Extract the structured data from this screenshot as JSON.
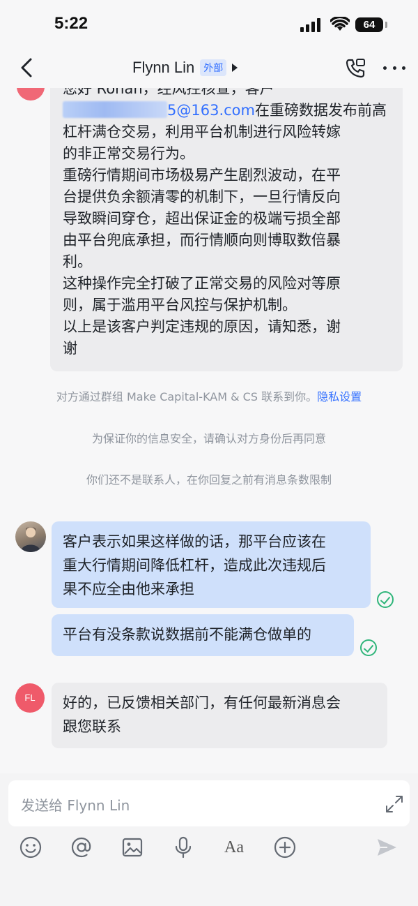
{
  "status_bar": {
    "time": "5:22",
    "battery": "64"
  },
  "nav": {
    "title": "Flynn Lin",
    "badge": "外部"
  },
  "messages": {
    "incoming_1": {
      "line1": "您好 Ronan，经风控核查，客户",
      "email_suffix": "5@163.com",
      "after_email": "在重磅数据发布前高\n杠杆满仓交易，利用平台机制进行风险转嫁\n的非正常交易行为。\n重磅行情期间市场极易产生剧烈波动，在平\n台提供负余额清零的机制下，一旦行情反向\n导致瞬间穿仓，超出保证金的极端亏损全部\n由平台兜底承担，而行情顺向则博取数倍暴\n利。\n这种操作完全打破了正常交易的风险对等原\n则，属于滥用平台风控与保护机制。\n以上是该客户判定违规的原因，请知悉，谢\n谢"
    },
    "outgoing_1": "客户表示如果这样做的话，那平台应该在\n重大行情期间降低杠杆，造成此次违规后\n果不应全由他来承担",
    "outgoing_2": "平台有没条款说数据前不能满仓做单的",
    "incoming_2": "好的，已反馈相关部门，有任何最新消息会\n跟您联系",
    "incoming_2_avatar": "FL"
  },
  "system": {
    "group_notice": "对方通过群组 Make Capital-KAM & CS 联系到你。",
    "privacy_link": "隐私设置",
    "security_notice": "为保证你的信息安全，请确认对方身份后再同意",
    "limit_notice": "你们还不是联系人，在你回复之前有消息条数限制"
  },
  "input": {
    "placeholder": "发送给 Flynn Lin"
  },
  "toolbar": {
    "font_label": "Aa"
  },
  "colors": {
    "accent": "#3370ff",
    "read_check": "#2fb57a",
    "outgoing_bubble": "#cfe0fb",
    "incoming_bubble": "#ececee"
  }
}
